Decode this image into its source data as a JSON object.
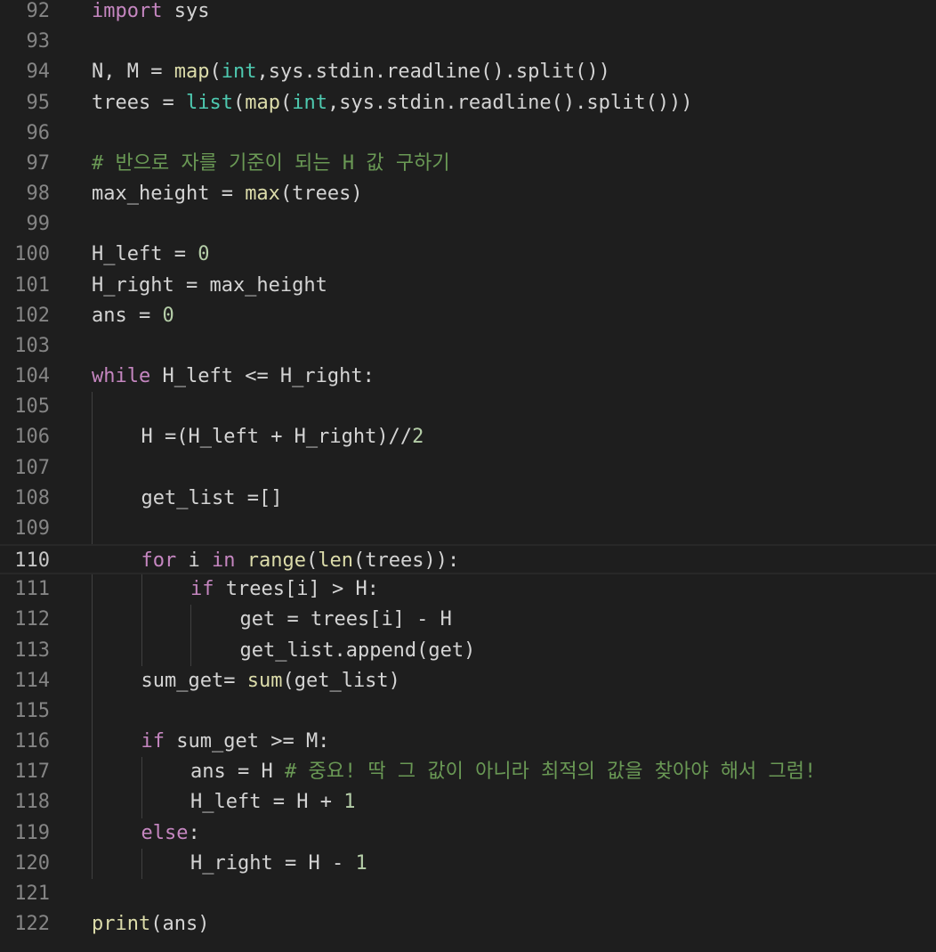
{
  "editor": {
    "theme_colors": {
      "background": "#1e1e1e",
      "keyword": "#c586c0",
      "function": "#dcdcaa",
      "type": "#4ec9b0",
      "number": "#b5cea8",
      "comment": "#6a9955",
      "text": "#d4d4d4",
      "line_number": "#858585"
    },
    "current_line": 110,
    "lines": [
      {
        "n": "92",
        "indent": 0,
        "tokens": [
          [
            "kw",
            "import"
          ],
          [
            "op",
            " sys"
          ]
        ]
      },
      {
        "n": "93",
        "indent": 0,
        "tokens": []
      },
      {
        "n": "94",
        "indent": 0,
        "tokens": [
          [
            "op",
            "N, M = "
          ],
          [
            "fn",
            "map"
          ],
          [
            "op",
            "("
          ],
          [
            "ty",
            "int"
          ],
          [
            "op",
            ",sys.stdin.readline().split())"
          ]
        ]
      },
      {
        "n": "95",
        "indent": 0,
        "tokens": [
          [
            "op",
            "trees = "
          ],
          [
            "ty",
            "list"
          ],
          [
            "op",
            "("
          ],
          [
            "fn",
            "map"
          ],
          [
            "op",
            "("
          ],
          [
            "ty",
            "int"
          ],
          [
            "op",
            ",sys.stdin.readline().split()))"
          ]
        ]
      },
      {
        "n": "96",
        "indent": 0,
        "tokens": []
      },
      {
        "n": "97",
        "indent": 0,
        "tokens": [
          [
            "cm",
            "# 반으로 자를 기준이 되는 H 값 구하기"
          ]
        ]
      },
      {
        "n": "98",
        "indent": 0,
        "tokens": [
          [
            "op",
            "max_height = "
          ],
          [
            "fn",
            "max"
          ],
          [
            "op",
            "(trees)"
          ]
        ]
      },
      {
        "n": "99",
        "indent": 0,
        "tokens": []
      },
      {
        "n": "100",
        "indent": 0,
        "tokens": [
          [
            "op",
            "H_left = "
          ],
          [
            "num",
            "0"
          ]
        ]
      },
      {
        "n": "101",
        "indent": 0,
        "tokens": [
          [
            "op",
            "H_right = max_height"
          ]
        ]
      },
      {
        "n": "102",
        "indent": 0,
        "tokens": [
          [
            "op",
            "ans = "
          ],
          [
            "num",
            "0"
          ]
        ]
      },
      {
        "n": "103",
        "indent": 0,
        "tokens": []
      },
      {
        "n": "104",
        "indent": 0,
        "tokens": [
          [
            "kw",
            "while"
          ],
          [
            "op",
            " H_left <= H_right:"
          ]
        ]
      },
      {
        "n": "105",
        "indent": 1,
        "tokens": []
      },
      {
        "n": "106",
        "indent": 1,
        "tokens": [
          [
            "op",
            "H =(H_left + H_right)//"
          ],
          [
            "num",
            "2"
          ]
        ]
      },
      {
        "n": "107",
        "indent": 1,
        "tokens": []
      },
      {
        "n": "108",
        "indent": 1,
        "tokens": [
          [
            "op",
            "get_list =[]"
          ]
        ]
      },
      {
        "n": "109",
        "indent": 1,
        "tokens": []
      },
      {
        "n": "110",
        "indent": 1,
        "tokens": [
          [
            "kw",
            "for"
          ],
          [
            "op",
            " i "
          ],
          [
            "kw",
            "in"
          ],
          [
            "op",
            " "
          ],
          [
            "fn",
            "range"
          ],
          [
            "op",
            "("
          ],
          [
            "fn",
            "len"
          ],
          [
            "op",
            "(trees)):"
          ]
        ]
      },
      {
        "n": "111",
        "indent": 2,
        "tokens": [
          [
            "kw",
            "if"
          ],
          [
            "op",
            " trees[i] > H:"
          ]
        ]
      },
      {
        "n": "112",
        "indent": 3,
        "tokens": [
          [
            "op",
            "get = trees[i] - H"
          ]
        ]
      },
      {
        "n": "113",
        "indent": 3,
        "tokens": [
          [
            "op",
            "get_list.append(get)"
          ]
        ]
      },
      {
        "n": "114",
        "indent": 1,
        "tokens": [
          [
            "op",
            "sum_get= "
          ],
          [
            "fn",
            "sum"
          ],
          [
            "op",
            "(get_list)"
          ]
        ]
      },
      {
        "n": "115",
        "indent": 1,
        "tokens": []
      },
      {
        "n": "116",
        "indent": 1,
        "tokens": [
          [
            "kw",
            "if"
          ],
          [
            "op",
            " sum_get >= M:"
          ]
        ]
      },
      {
        "n": "117",
        "indent": 2,
        "tokens": [
          [
            "op",
            "ans = H "
          ],
          [
            "cm",
            "# 중요! 딱 그 값이 아니라 최적의 값을 찾아야 해서 그럼!"
          ]
        ]
      },
      {
        "n": "118",
        "indent": 2,
        "tokens": [
          [
            "op",
            "H_left = H + "
          ],
          [
            "num",
            "1"
          ]
        ]
      },
      {
        "n": "119",
        "indent": 1,
        "tokens": [
          [
            "kw",
            "else"
          ],
          [
            "op",
            ":"
          ]
        ]
      },
      {
        "n": "120",
        "indent": 2,
        "tokens": [
          [
            "op",
            "H_right = H - "
          ],
          [
            "num",
            "1"
          ]
        ]
      },
      {
        "n": "121",
        "indent": 0,
        "tokens": []
      },
      {
        "n": "122",
        "indent": 0,
        "tokens": [
          [
            "fn",
            "print"
          ],
          [
            "op",
            "(ans)"
          ]
        ]
      }
    ]
  }
}
